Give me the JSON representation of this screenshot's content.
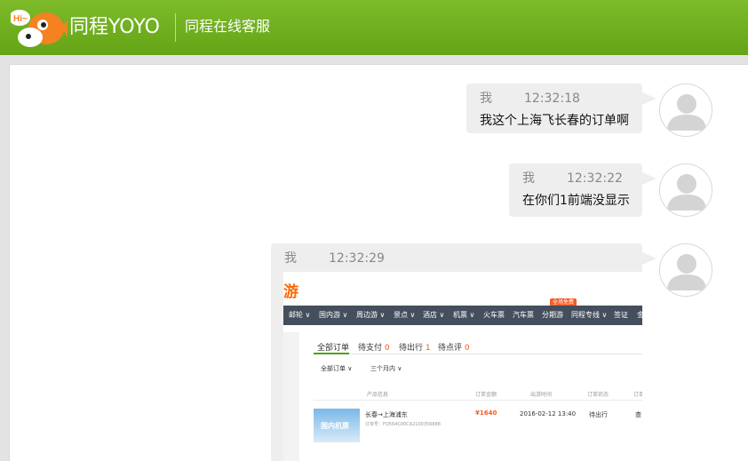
{
  "header": {
    "brand": "同程YOYO",
    "subtitle": "同程在线客服",
    "logo_icon": "fish-mascot-logo-icon",
    "logo_text": "Hi~"
  },
  "colors": {
    "header_green": "#6aaa1c",
    "bubble_bg": "#eeeeee",
    "accent_orange": "#f55b25",
    "accent_green": "#4aa216"
  },
  "messages": [
    {
      "sender": "我",
      "time": "12:32:18",
      "text": "我这个上海飞长春的订单啊"
    },
    {
      "sender": "我",
      "time": "12:32:22",
      "text": "在你们1前端没显示"
    },
    {
      "sender": "我",
      "time": "12:32:29",
      "text": ""
    }
  ],
  "screenshot": {
    "logo_partial": "游",
    "badge": "全场免费",
    "nav": [
      "邮轮 ∨",
      "国内游 ∨",
      "周边游 ∨",
      "景点 ∨",
      "酒店 ∨",
      "机票 ∨",
      "火车票",
      "汽车票",
      "分期游",
      "同程专线 ∨",
      "签证",
      "金"
    ],
    "tabs": [
      {
        "label": "全部订单",
        "count": ""
      },
      {
        "label": "待支付",
        "count": "0"
      },
      {
        "label": "待出行",
        "count": "1"
      },
      {
        "label": "待点评",
        "count": "0"
      }
    ],
    "filters": [
      "全部订单 ∨",
      "三个月内 ∨"
    ],
    "columns": [
      "产品信息",
      "订单金额",
      "出游时间",
      "订单状态",
      "订单"
    ],
    "order": {
      "title": "长春→上海浦东",
      "number": "订单号：FQ564C00CA2100356888",
      "image_text": "国内机票",
      "amount": "¥1640",
      "date": "2016-02-12 13:40",
      "status": "待出行",
      "action": "查"
    }
  }
}
